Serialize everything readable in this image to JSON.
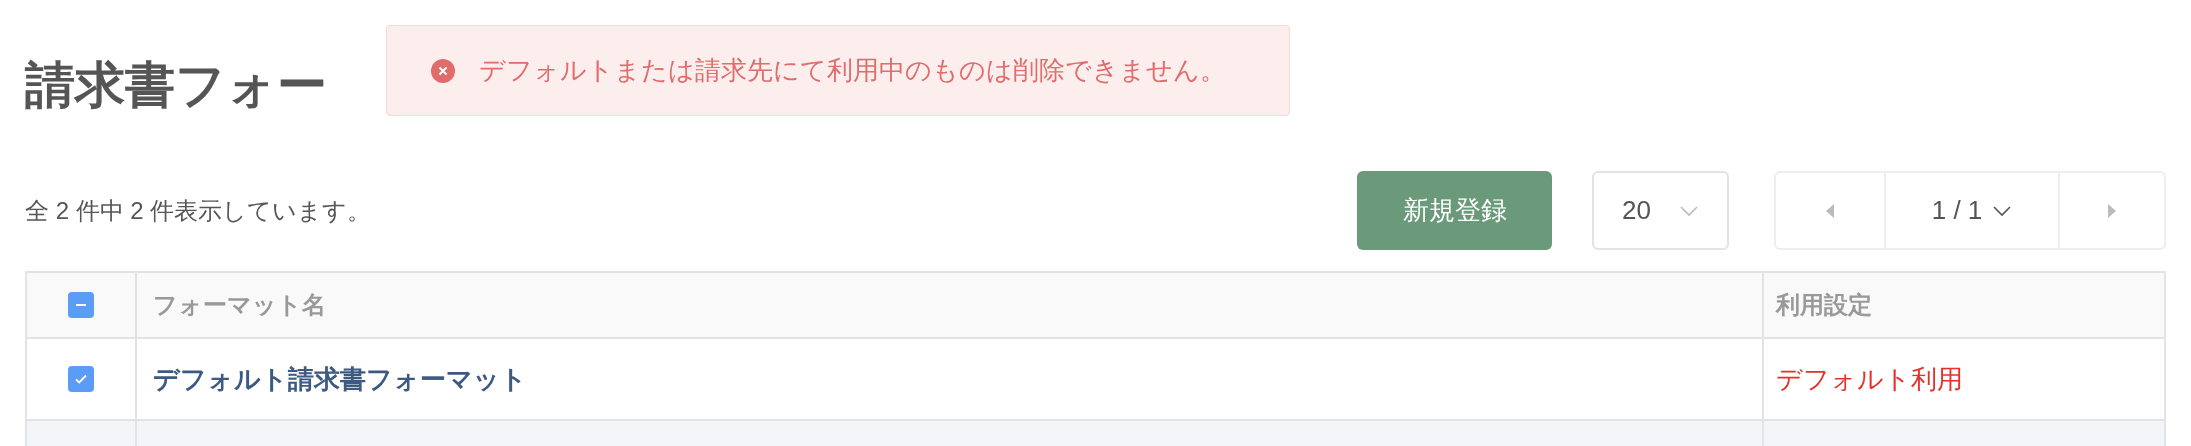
{
  "page": {
    "title": "請求書フォー"
  },
  "toast": {
    "kind": "error",
    "message": "デフォルトまたは請求先にて利用中のものは削除できません。"
  },
  "summary": "全 2 件中 2 件表示しています。",
  "new_button": "新規登録",
  "page_size": {
    "value": "20"
  },
  "pagination": {
    "current": "1 / 1"
  },
  "table": {
    "select_all": {
      "indeterminate": true
    },
    "columns": [
      "フォーマット名",
      "利用設定"
    ],
    "rows": [
      {
        "checked": true,
        "name": "デフォルト請求書フォーマット",
        "usage": "デフォルト利用"
      }
    ]
  }
}
